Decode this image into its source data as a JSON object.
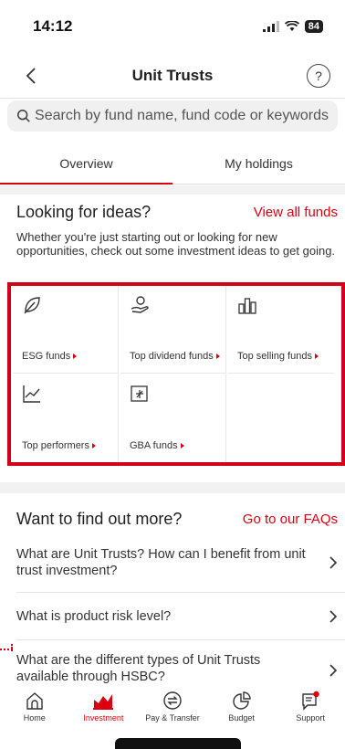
{
  "status_bar": {
    "time": "14:12",
    "battery": "84"
  },
  "header": {
    "title": "Unit Trusts",
    "help": "?"
  },
  "search": {
    "placeholder": "Search by fund name, fund code or keywords"
  },
  "tabs": [
    {
      "label": "Overview",
      "active": true
    },
    {
      "label": "My holdings",
      "active": false
    }
  ],
  "ideas": {
    "title": "Looking for ideas?",
    "link": "View all funds",
    "description": "Whether you're just starting out or looking for new opportunities, check out some investment ideas to get going.",
    "items": [
      {
        "label": "ESG funds",
        "icon": "leaf-icon"
      },
      {
        "label": "Top dividend funds",
        "icon": "hand-coin-icon"
      },
      {
        "label": "Top selling funds",
        "icon": "bar-chart-icon"
      },
      {
        "label": "Top performers",
        "icon": "line-chart-icon"
      },
      {
        "label": "GBA funds",
        "icon": "gba-icon"
      }
    ]
  },
  "faq": {
    "title": "Want to find out more?",
    "link": "Go to our FAQs",
    "items": [
      {
        "text": "What are Unit Trusts? How can I benefit from unit trust investment?"
      },
      {
        "text": "What is product risk level?"
      },
      {
        "text": "What are the different types of Unit Trusts available through HSBC?"
      }
    ]
  },
  "bottom_nav": [
    {
      "label": "Home",
      "icon": "home-icon",
      "active": false
    },
    {
      "label": "Investment",
      "icon": "investment-icon",
      "active": true
    },
    {
      "label": "Pay & Transfer",
      "icon": "transfer-icon",
      "active": false
    },
    {
      "label": "Budget",
      "icon": "budget-icon",
      "active": false
    },
    {
      "label": "Support",
      "icon": "support-icon",
      "active": false
    }
  ],
  "colors": {
    "accent": "#db0011",
    "highlight": "#d0021b",
    "band": "#f2f2f2"
  }
}
